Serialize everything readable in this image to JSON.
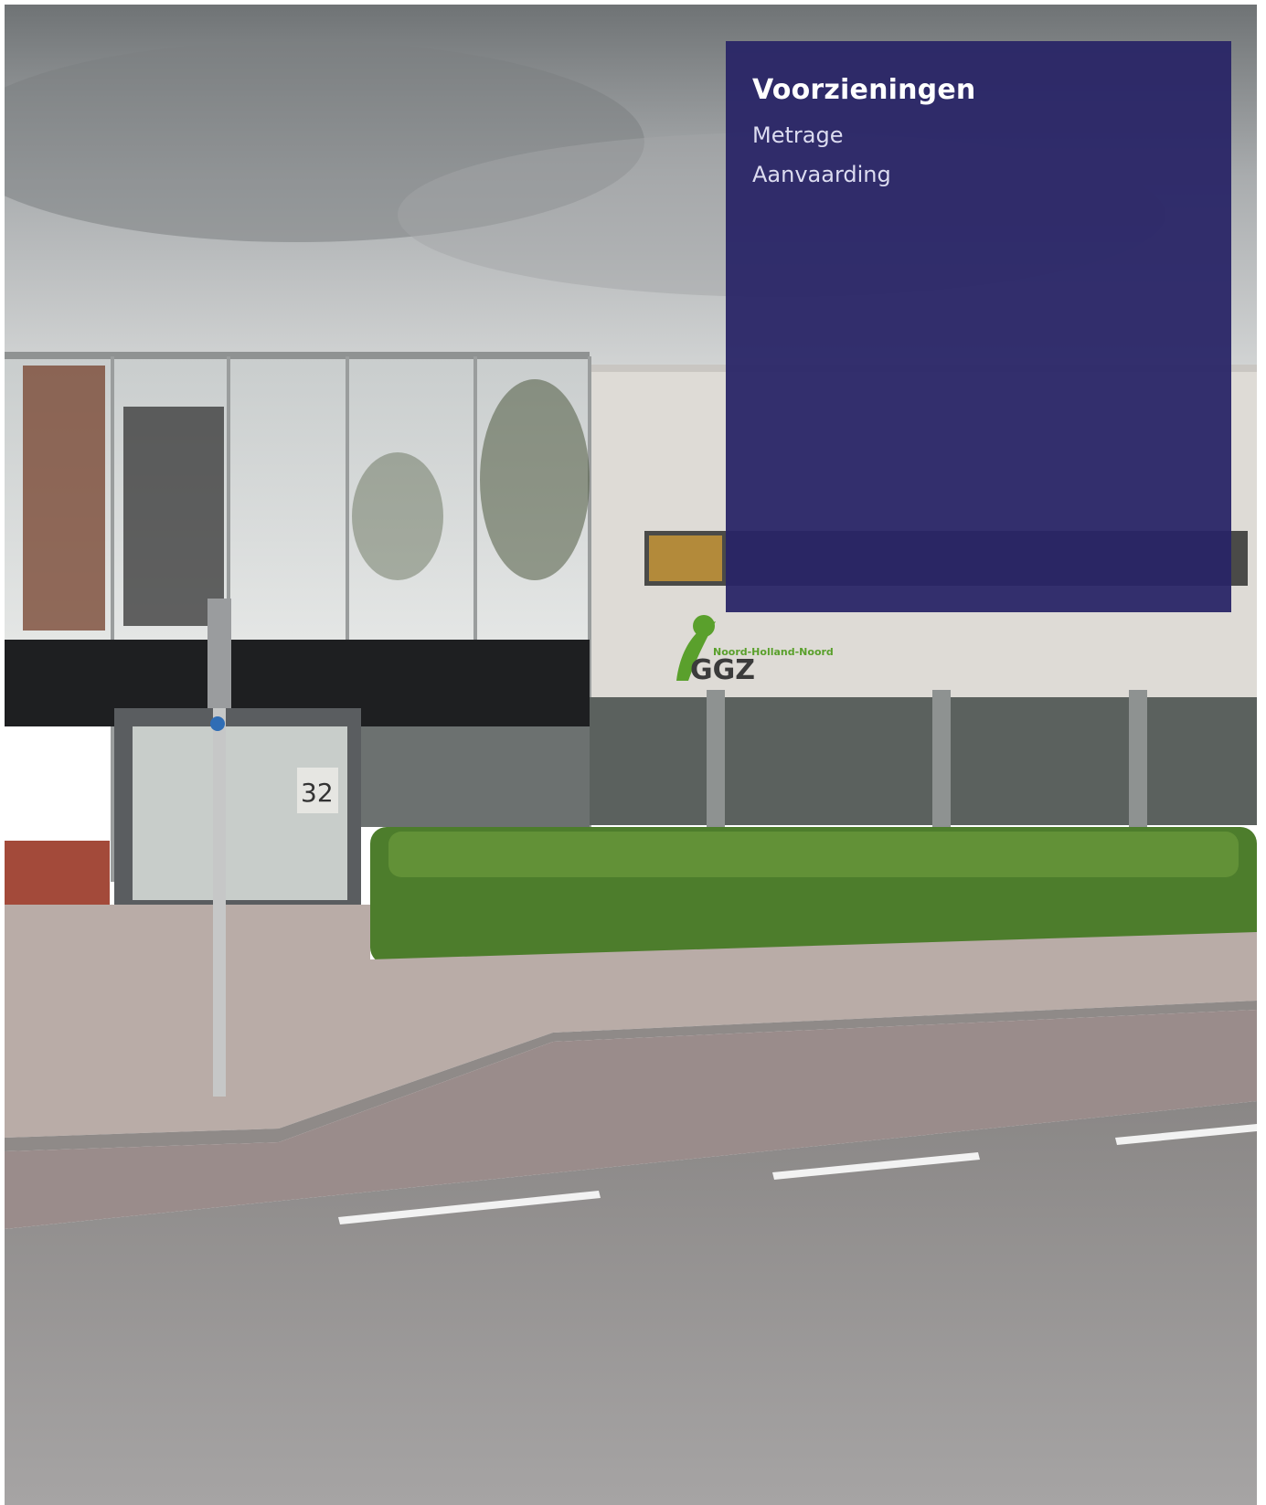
{
  "panel": {
    "title": "Voorzieningen",
    "items": [
      {
        "label": "Metrage"
      },
      {
        "label": "Aanvaarding"
      }
    ],
    "background_color": "#282466"
  },
  "photo": {
    "logo_name": "GGZ",
    "logo_subtitle": "Noord-Holland-Noord",
    "house_number": "32"
  },
  "colors": {
    "logo_green": "#5aa02c",
    "panel_text": "#ffffff",
    "panel_items": "#dcdcf0"
  }
}
